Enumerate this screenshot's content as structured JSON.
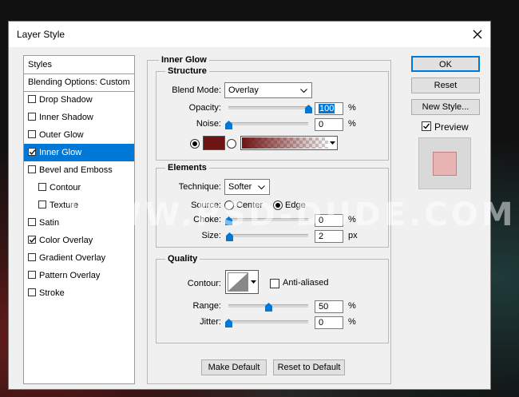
{
  "window": {
    "title": "Layer Style"
  },
  "styles_panel": {
    "header": "Styles",
    "blending": "Blending Options: Custom",
    "items": [
      {
        "label": "Drop Shadow",
        "checked": false,
        "selected": false,
        "indent": false
      },
      {
        "label": "Inner Shadow",
        "checked": false,
        "selected": false,
        "indent": false
      },
      {
        "label": "Outer Glow",
        "checked": false,
        "selected": false,
        "indent": false
      },
      {
        "label": "Inner Glow",
        "checked": true,
        "selected": true,
        "indent": false
      },
      {
        "label": "Bevel and Emboss",
        "checked": false,
        "selected": false,
        "indent": false
      },
      {
        "label": "Contour",
        "checked": false,
        "selected": false,
        "indent": true
      },
      {
        "label": "Texture",
        "checked": false,
        "selected": false,
        "indent": true
      },
      {
        "label": "Satin",
        "checked": false,
        "selected": false,
        "indent": false
      },
      {
        "label": "Color Overlay",
        "checked": true,
        "selected": false,
        "indent": false
      },
      {
        "label": "Gradient Overlay",
        "checked": false,
        "selected": false,
        "indent": false
      },
      {
        "label": "Pattern Overlay",
        "checked": false,
        "selected": false,
        "indent": false
      },
      {
        "label": "Stroke",
        "checked": false,
        "selected": false,
        "indent": false
      }
    ]
  },
  "inner_glow": {
    "title": "Inner Glow",
    "structure": {
      "title": "Structure",
      "blend_mode_label": "Blend Mode:",
      "blend_mode": "Overlay",
      "opacity_label": "Opacity:",
      "opacity": "100",
      "opacity_unit": "%",
      "opacity_level": 1.0,
      "noise_label": "Noise:",
      "noise": "0",
      "noise_unit": "%",
      "noise_level": 0.0,
      "glow_color": "#6e1414"
    },
    "elements": {
      "title": "Elements",
      "technique_label": "Technique:",
      "technique": "Softer",
      "source_label": "Source:",
      "source_center": "Center",
      "source_edge": "Edge",
      "choke_label": "Choke:",
      "choke": "0",
      "choke_unit": "%",
      "choke_level": 0.0,
      "size_label": "Size:",
      "size": "2",
      "size_unit": "px",
      "size_level": 0.01
    },
    "quality": {
      "title": "Quality",
      "contour_label": "Contour:",
      "anti_aliased_label": "Anti-aliased",
      "range_label": "Range:",
      "range": "50",
      "range_unit": "%",
      "range_level": 0.5,
      "jitter_label": "Jitter:",
      "jitter": "0",
      "jitter_unit": "%",
      "jitter_level": 0.0
    },
    "make_default": "Make Default",
    "reset_default": "Reset to Default"
  },
  "buttons": {
    "ok": "OK",
    "reset": "Reset",
    "new_style": "New Style...",
    "preview_label": "Preview"
  },
  "preview_color": "#e8b4b4",
  "watermark": "WWW.PSD-DUDE.COM",
  "colors": {
    "accent": "#0078d7"
  }
}
